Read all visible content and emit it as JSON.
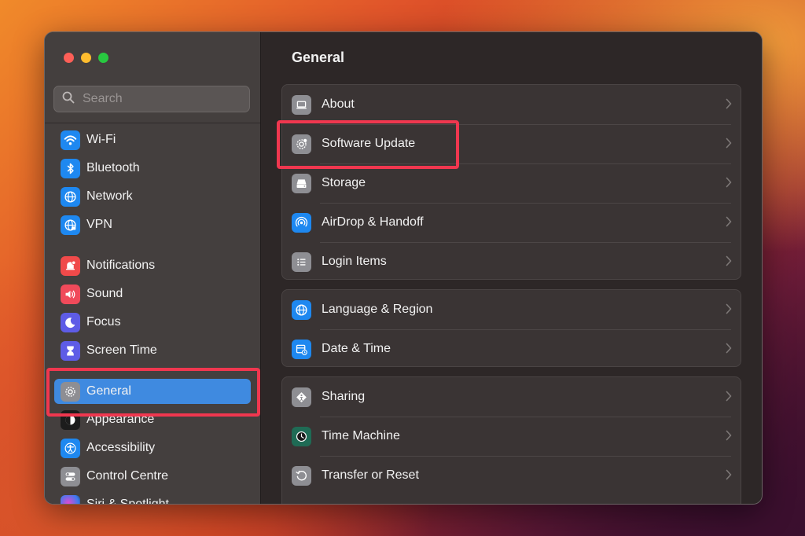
{
  "window": {
    "traffic_lights": [
      "close",
      "minimize",
      "zoom"
    ]
  },
  "sidebar": {
    "search": {
      "placeholder": "Search",
      "value": ""
    },
    "items": [
      {
        "label": "Wi-Fi",
        "icon": "wifi-icon",
        "color": "#1e88f0"
      },
      {
        "label": "Bluetooth",
        "icon": "bluetooth-icon",
        "color": "#1e88f0"
      },
      {
        "label": "Network",
        "icon": "globe-icon",
        "color": "#1e88f0"
      },
      {
        "label": "VPN",
        "icon": "vpn-globe-icon",
        "color": "#1e88f0"
      },
      {
        "label": "Notifications",
        "icon": "bell-icon",
        "color": "#f04a4a"
      },
      {
        "label": "Sound",
        "icon": "speaker-icon",
        "color": "#f04a5a"
      },
      {
        "label": "Focus",
        "icon": "moon-icon",
        "color": "#5e5ce6"
      },
      {
        "label": "Screen Time",
        "icon": "hourglass-icon",
        "color": "#5e5ce6"
      },
      {
        "label": "General",
        "icon": "gear-icon",
        "color": "#8e8e93",
        "selected": true
      },
      {
        "label": "Appearance",
        "icon": "appearance-icon",
        "color": "#1c1c1c"
      },
      {
        "label": "Accessibility",
        "icon": "accessibility-icon",
        "color": "#1e88f0"
      },
      {
        "label": "Control Centre",
        "icon": "toggles-icon",
        "color": "#8e8e93"
      },
      {
        "label": "Siri & Spotlight",
        "icon": "siri-icon",
        "color": "#333333"
      }
    ]
  },
  "main": {
    "title": "General",
    "groups": [
      [
        {
          "label": "About",
          "icon": "laptop-icon",
          "color": "#8e8e93"
        },
        {
          "label": "Software Update",
          "icon": "gear-badge-icon",
          "color": "#8e8e93",
          "highlighted": true
        },
        {
          "label": "Storage",
          "icon": "drive-icon",
          "color": "#8e8e93"
        },
        {
          "label": "AirDrop & Handoff",
          "icon": "airdrop-icon",
          "color": "#1e88f0"
        },
        {
          "label": "Login Items",
          "icon": "list-icon",
          "color": "#8e8e93"
        }
      ],
      [
        {
          "label": "Language & Region",
          "icon": "globe-icon",
          "color": "#1e88f0"
        },
        {
          "label": "Date & Time",
          "icon": "calendar-clock-icon",
          "color": "#1e88f0"
        }
      ],
      [
        {
          "label": "Sharing",
          "icon": "sharing-icon",
          "color": "#8e8e93"
        },
        {
          "label": "Time Machine",
          "icon": "time-machine-icon",
          "color": "#1f6b55"
        },
        {
          "label": "Transfer or Reset",
          "icon": "reset-icon",
          "color": "#8e8e93"
        }
      ]
    ]
  },
  "highlights": {
    "color": "#f0374f",
    "targets": [
      "sidebar-item-general",
      "row-software-update"
    ]
  }
}
